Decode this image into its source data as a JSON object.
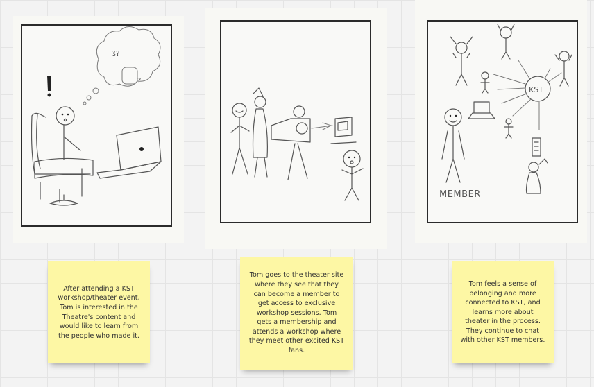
{
  "board": {
    "panels": [
      {
        "id": "panel-1",
        "note": "After attending a KST workshop/theater event, Tom is interested in the Theatre's content and would like to learn from the people who made it."
      },
      {
        "id": "panel-2",
        "note": "Tom goes to the theater site where they see that they can become a member to get access to exclusive workshop sessions. Tom gets a membership and attends a workshop where they meet other excited KST fans."
      },
      {
        "id": "panel-3",
        "note": "Tom feels a sense of belonging and more connected to KST, and learns more about theater in the process. They continue to chat with other KST members.",
        "sketch_labels": {
          "hub": "KST",
          "member": "MEMBER"
        }
      }
    ]
  },
  "colors": {
    "sticky": "#fdf7a4",
    "canvas": "#f3f3f3",
    "frame": "#2b2b2b"
  }
}
